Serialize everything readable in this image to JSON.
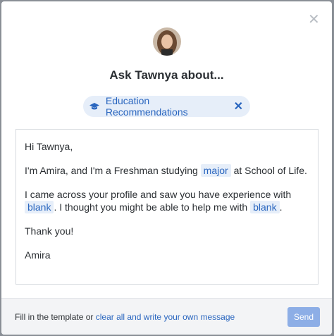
{
  "dialog": {
    "title": "Ask Tawnya about...",
    "close_icon": "close-icon"
  },
  "topic": {
    "icon": "graduation-cap-icon",
    "label": "Education Recommendations"
  },
  "message": {
    "greeting": "Hi Tawnya,",
    "line1_a": "I'm Amira, and I'm a Freshman studying",
    "line1_token": "major",
    "line1_b": "at School of Life.",
    "line2_a": "I came across your profile and saw you have experience with",
    "line2_token1": "blank",
    "line2_b": ". I thought you might be able to help me with",
    "line2_token2": "blank",
    "line2_c": ".",
    "thanks": "Thank you!",
    "signature": "Amira"
  },
  "footer": {
    "prefix": "Fill in the template or",
    "link": "clear all and write your own message",
    "send_label": "Send"
  },
  "colors": {
    "accent": "#2a66bf",
    "chip_bg": "#e6eef9",
    "send_bg": "#8daee6"
  }
}
